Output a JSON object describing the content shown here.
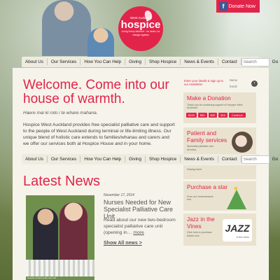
{
  "header": {
    "donate_label": "Donate Now",
    "facebook_glyph": "f",
    "logo": {
      "subtitle": "West Auckland",
      "name": "hospice",
      "tagline": "Living Every Moment · he ahiko, he orange ngakau"
    }
  },
  "nav": {
    "items": [
      "About Us",
      "Our Services",
      "How You Can Help",
      "Giving",
      "Shop Hospice",
      "News & Events",
      "Contact"
    ],
    "search_placeholder": "Search",
    "go_label": "Go"
  },
  "welcome": {
    "heading": "Welcome. Come into our house of warmth.",
    "maori": "Haere mai ki roto i te whare mahana.",
    "body": "Hospice West Auckland provides free specialist palliative care and support to the people of West Auckland during terminal or life-limiting illness. Our unique blend of holistic care extends to families/whanau and carers and we offer our services both at Hospice House and in your home."
  },
  "newsletter": {
    "label": "Enter your details & sign up to our newsletter",
    "name_placeholder": "Name",
    "email_placeholder": "Email"
  },
  "sidebar": {
    "donation": {
      "title": "Make a Donation",
      "desc": "Thank you for continuing support of Hospice West Auckland.",
      "amounts": [
        "$100",
        "$50",
        "$20",
        "$10"
      ],
      "continue_label": "Continue"
    },
    "family": {
      "title": "Patient and Family services",
      "desc": "Specialist palliative care services."
    },
    "helping": {
      "desc": "helping hand."
    },
    "star": {
      "title": "Purchase a star",
      "desc": "From our remembrance tree."
    },
    "jazz": {
      "title": "Jazz in the Vines",
      "desc": "Click here to purchase tickets now",
      "logo_text": "JAZZ",
      "logo_sub": "in the Vines"
    }
  },
  "news": {
    "heading": "Latest News",
    "date": "November 17, 2014",
    "headline": "Nurses Needed for New Specialist Palliative Care Unit",
    "lede": "Read about our new two-bedroom specialist palliative care unit (opening in… ",
    "more_label": "more",
    "show_all": "Show All news >",
    "caption": "Hospice nurses at the new unit"
  },
  "colors": {
    "brand": "#e2244a",
    "panel": "#f6f3ea",
    "nav_bg": "#eeebe0",
    "card_bg": "#e9e2cf"
  }
}
